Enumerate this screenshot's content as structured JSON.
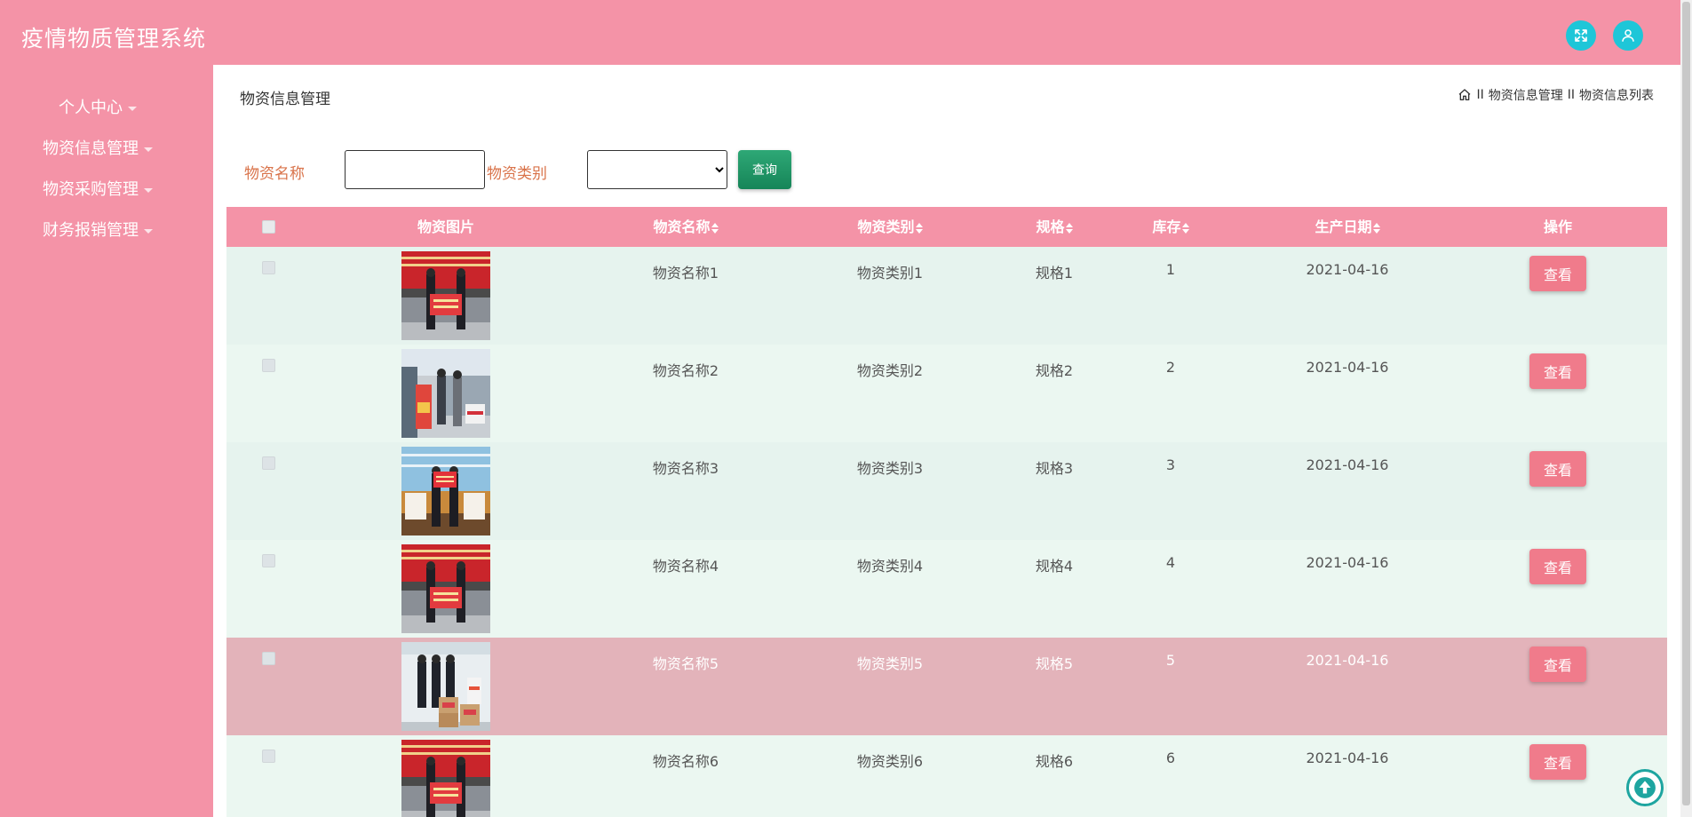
{
  "app": {
    "title": "疫情物质管理系统"
  },
  "sidebar": {
    "items": [
      {
        "label": "个人中心"
      },
      {
        "label": "物资信息管理"
      },
      {
        "label": "物资采购管理"
      },
      {
        "label": "财务报销管理"
      }
    ]
  },
  "page": {
    "title": "物资信息管理",
    "breadcrumb": [
      "物资信息管理",
      "物资信息列表"
    ],
    "breadcrumb_separator": "II"
  },
  "search": {
    "name_label": "物资名称",
    "name_value": "",
    "category_label": "物资类别",
    "category_value": "",
    "button_label": "查询"
  },
  "table": {
    "columns": [
      "物资图片",
      "物资名称",
      "物资类别",
      "规格",
      "库存",
      "生产日期",
      "操作"
    ],
    "action_label": "查看",
    "rows": [
      {
        "name": "物资名称1",
        "category": "物资类别1",
        "spec": "规格1",
        "stock": "1",
        "date": "2021-04-16"
      },
      {
        "name": "物资名称2",
        "category": "物资类别2",
        "spec": "规格2",
        "stock": "2",
        "date": "2021-04-16"
      },
      {
        "name": "物资名称3",
        "category": "物资类别3",
        "spec": "规格3",
        "stock": "3",
        "date": "2021-04-16"
      },
      {
        "name": "物资名称4",
        "category": "物资类别4",
        "spec": "规格4",
        "stock": "4",
        "date": "2021-04-16"
      },
      {
        "name": "物资名称5",
        "category": "物资类别5",
        "spec": "规格5",
        "stock": "5",
        "date": "2021-04-16"
      },
      {
        "name": "物资名称6",
        "category": "物资类别6",
        "spec": "规格6",
        "stock": "6",
        "date": "2021-04-16"
      }
    ]
  },
  "colors": {
    "primary": "#f493a7",
    "accent_button": "#f07b8b",
    "search_button": "#168558",
    "label_text": "#d9734a",
    "row_hover": "#e3b3ba",
    "icon_button": "#1ec6d8"
  },
  "icons": {
    "fullscreen": "expand-icon",
    "user": "user-icon",
    "home": "home-icon",
    "scroll_top": "arrow-up-icon"
  }
}
